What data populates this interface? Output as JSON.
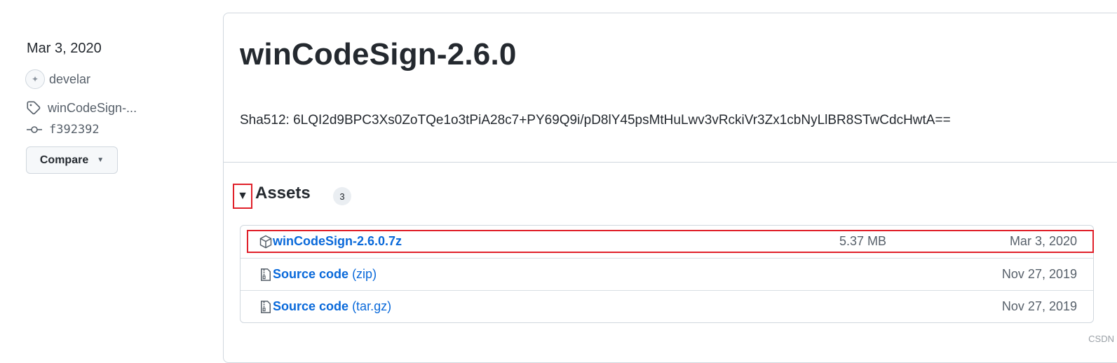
{
  "sidebar": {
    "date": "Mar 3, 2020",
    "author": "develar",
    "tag": "winCodeSign-...",
    "commit": "f392392",
    "compare_label": "Compare"
  },
  "release": {
    "title": "winCodeSign-2.6.0",
    "sha": "Sha512: 6LQI2d9BPC3Xs0ZoTQe1o3tPiA28c7+PY69Q9i/pD8lY45psMtHuLwv3vRckiVr3Zx1cbNyLlBR8STwCdcHwtA=="
  },
  "assets": {
    "toggle_glyph": "▼",
    "title": "Assets",
    "count": "3",
    "items": [
      {
        "name": "winCodeSign-2.6.0.7z",
        "format": "",
        "size": "5.37 MB",
        "date": "Mar 3, 2020",
        "icon": "package-icon"
      },
      {
        "name": "Source code",
        "format": "(zip)",
        "size": "",
        "date": "Nov 27, 2019",
        "icon": "file-zip-icon"
      },
      {
        "name": "Source code",
        "format": "(tar.gz)",
        "size": "",
        "date": "Nov 27, 2019",
        "icon": "file-zip-icon"
      }
    ]
  },
  "watermark": "CSDN",
  "colors": {
    "link": "#0969da",
    "highlight": "#e0202a",
    "border": "#d0d7de"
  }
}
